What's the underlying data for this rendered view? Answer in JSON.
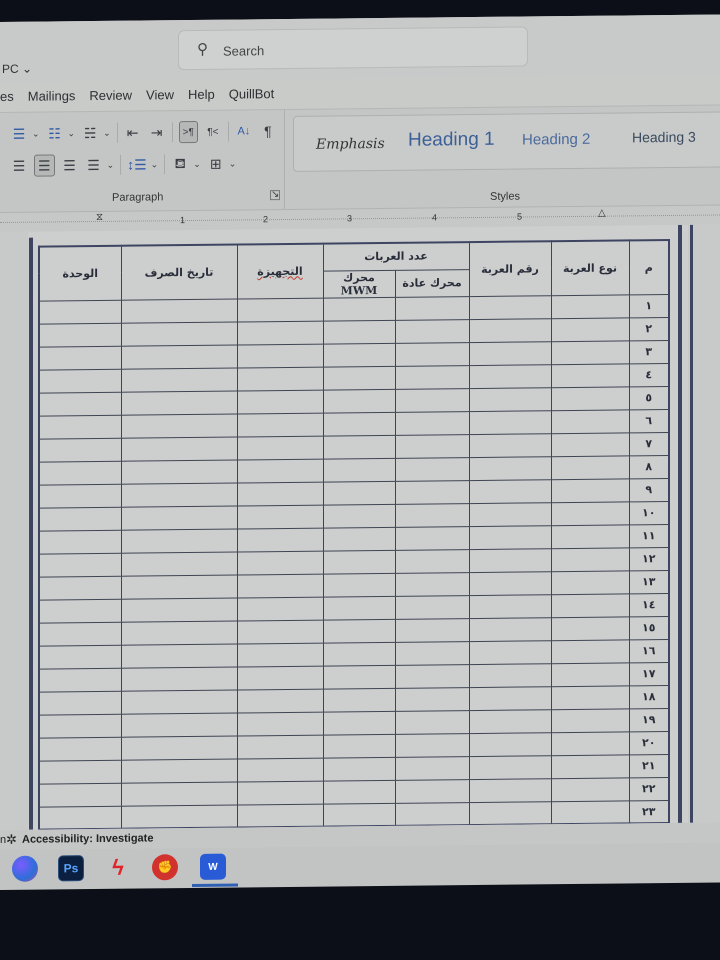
{
  "window": {
    "account_label": "PC",
    "search_placeholder": "Search"
  },
  "ribbon_tabs": [
    "es",
    "Mailings",
    "Review",
    "View",
    "Help",
    "QuillBot"
  ],
  "ribbon": {
    "paragraph_group_label": "Paragraph",
    "styles_group_label": "Styles",
    "styles": [
      "Emphasis",
      "Heading 1",
      "Heading 2",
      "Heading 3"
    ],
    "paragraph_buttons_row1": [
      "bullets",
      "numbering",
      "multilevel-list",
      "decrease-indent",
      "increase-indent",
      "ltr-direction",
      "rtl-direction",
      "sort",
      "show-formatting-marks"
    ],
    "paragraph_buttons_row2": [
      "align-left",
      "center",
      "align-right",
      "justify",
      "line-spacing",
      "shading",
      "borders"
    ]
  },
  "ruler": {
    "numbers": [
      "1",
      "2",
      "3",
      "4",
      "5"
    ]
  },
  "table": {
    "headers": {
      "index": "م",
      "vehicle_type": "نوع العربة",
      "vehicle_number": "رقم العربة",
      "vehicle_count_group": "عدد العربات",
      "engine_regular": "محرك عادة",
      "engine_mwm_line1": "محرك",
      "engine_mwm_line2": "MWM",
      "equipment": "التجهيزة",
      "issue_date": "تاريخ الصرف",
      "unit": "الوحدة"
    },
    "row_numbers": [
      "١",
      "٢",
      "٣",
      "٤",
      "٥",
      "٦",
      "٧",
      "٨",
      "٩",
      "١٠",
      "١١",
      "١٢",
      "١٣",
      "١٤",
      "١٥",
      "١٦",
      "١٧",
      "١٨",
      "١٩",
      "٢٠",
      "٢١",
      "٢٢",
      "٢٣"
    ]
  },
  "status_bar": {
    "accessibility": "Accessibility: Investigate"
  },
  "taskbar": {
    "apps": [
      "Microsoft 365 Copilot",
      "Photoshop",
      "Bolt app",
      "Red fist app",
      "Word"
    ],
    "ps_label": "Ps",
    "word_label": "W"
  }
}
